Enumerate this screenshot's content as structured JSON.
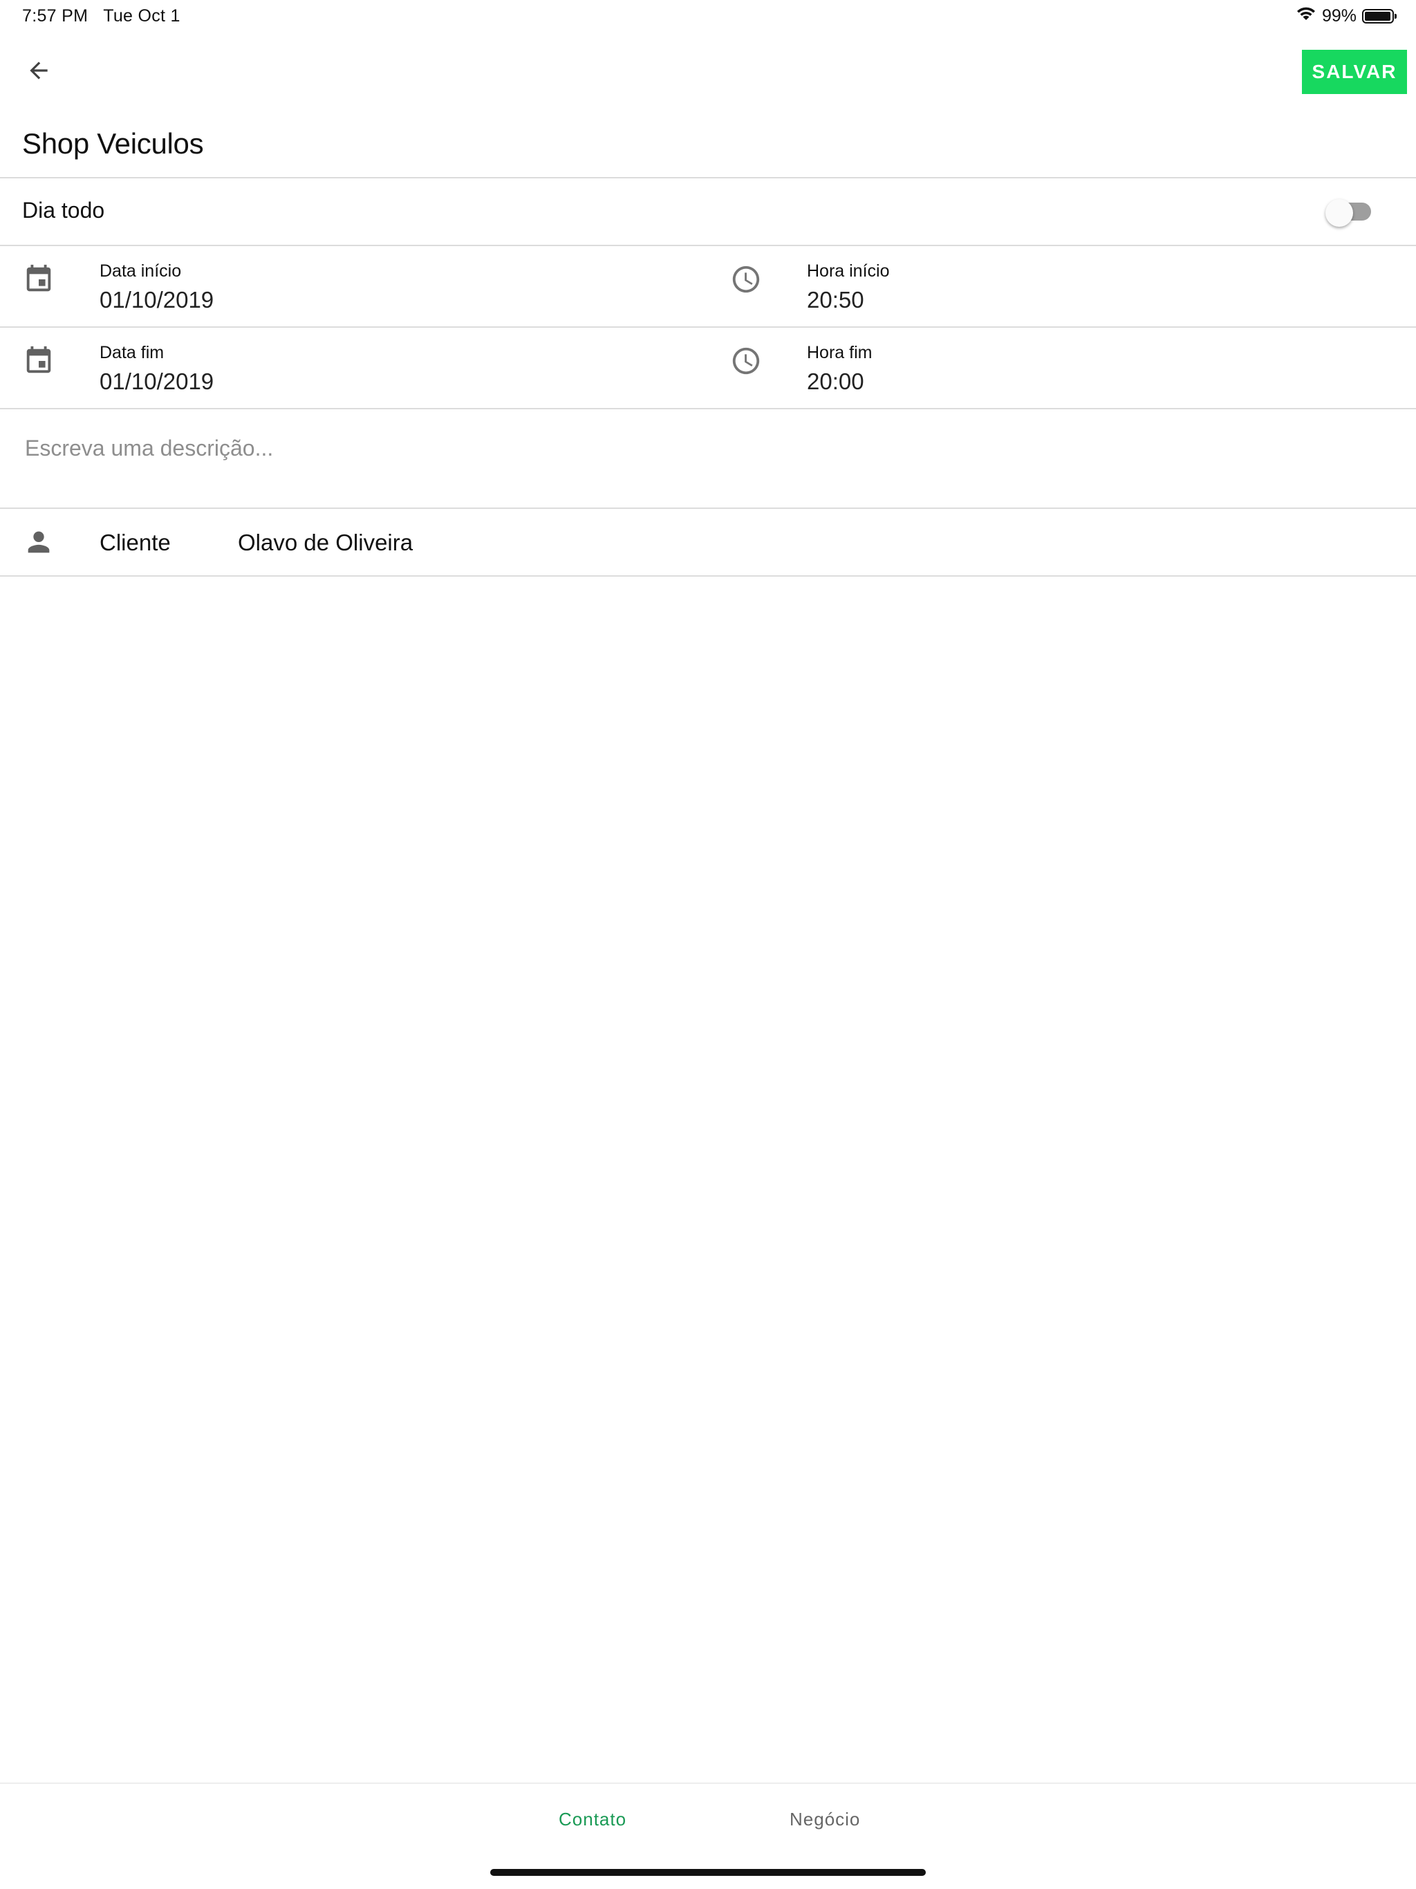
{
  "status_bar": {
    "time": "7:57 PM",
    "date": "Tue Oct 1",
    "battery": "99%"
  },
  "toolbar": {
    "save_label": "SALVAR"
  },
  "event": {
    "title": "Shop Veiculos"
  },
  "all_day": {
    "label": "Dia todo",
    "enabled": false
  },
  "start": {
    "date_label": "Data início",
    "date_value": "01/10/2019",
    "time_label": "Hora início",
    "time_value": "20:50"
  },
  "end": {
    "date_label": "Data fim",
    "date_value": "01/10/2019",
    "time_label": "Hora fim",
    "time_value": "20:00"
  },
  "description": {
    "placeholder": "Escreva uma descrição..."
  },
  "client": {
    "label": "Cliente",
    "value": "Olavo de Oliveira"
  },
  "tabs": [
    {
      "label": "Contato",
      "active": true
    },
    {
      "label": "Negócio",
      "active": false
    }
  ],
  "colors": {
    "accent": "#17d85f",
    "tab_active": "#1a9a55",
    "icon": "#616161"
  }
}
